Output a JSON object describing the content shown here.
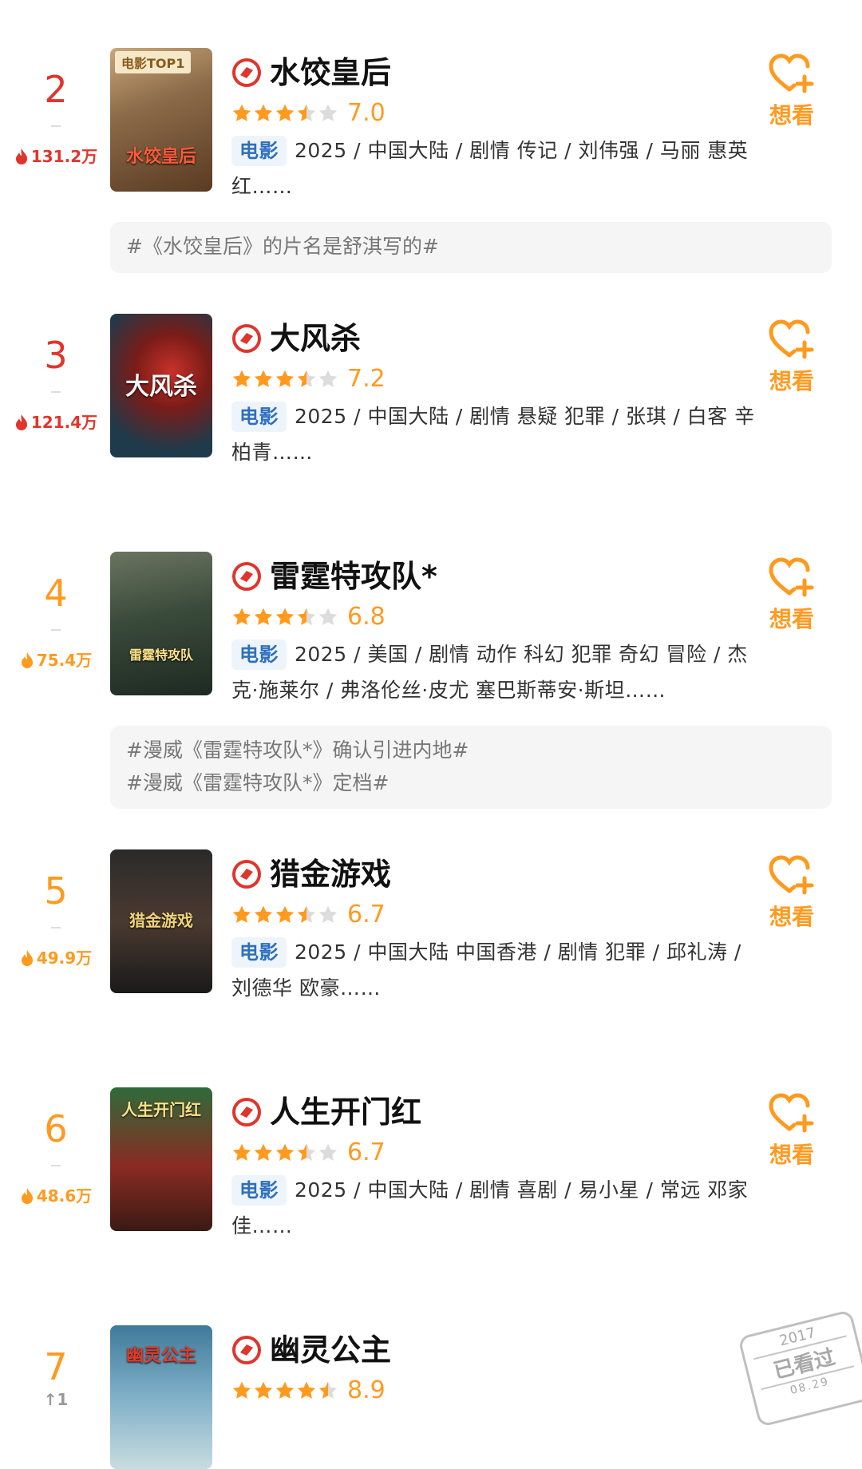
{
  "colors": {
    "rank_red": "#e0352c",
    "rank_orange": "#ff9a1f",
    "star_filled": "#ff9a1f",
    "star_empty": "#dcdcdc",
    "badge_text": "#2e6fbf",
    "want": "#ff9a1f"
  },
  "movies": [
    {
      "rank": "2",
      "heat": "131.2万",
      "title": "水饺皇后",
      "stars": 3.5,
      "score": "7.0",
      "category": "电影",
      "desc": "2025 / 中国大陆 / 剧情 传记 / 刘伟强 / 马丽 惠英红……",
      "want_label": "想看",
      "poster_tag": "电影TOP1",
      "poster_title": "水饺皇后",
      "topics": [
        "#《水饺皇后》的片名是舒淇写的#"
      ]
    },
    {
      "rank": "3",
      "heat": "121.4万",
      "title": "大风杀",
      "stars": 3.5,
      "score": "7.2",
      "category": "电影",
      "desc": "2025 / 中国大陆 / 剧情 悬疑 犯罪 / 张琪 / 白客 辛柏青……",
      "want_label": "想看",
      "poster_title": "大风杀"
    },
    {
      "rank": "4",
      "heat": "75.4万",
      "title": "雷霆特攻队*",
      "stars": 3.5,
      "score": "6.8",
      "category": "电影",
      "desc": "2025 / 美国 / 剧情 动作 科幻 犯罪 奇幻 冒险 / 杰克·施莱尔 / 弗洛伦丝·皮尤 塞巴斯蒂安·斯坦……",
      "want_label": "想看",
      "poster_title": "雷霆特攻队",
      "topics": [
        "#漫威《雷霆特攻队*》确认引进内地#",
        "#漫威《雷霆特攻队*》定档#"
      ]
    },
    {
      "rank": "5",
      "heat": "49.9万",
      "title": "猎金游戏",
      "stars": 3.5,
      "score": "6.7",
      "category": "电影",
      "desc": "2025 / 中国大陆 中国香港 / 剧情 犯罪 / 邱礼涛 / 刘德华 欧豪……",
      "want_label": "想看",
      "poster_title": "猎金游戏"
    },
    {
      "rank": "6",
      "heat": "48.6万",
      "title": "人生开门红",
      "stars": 3.5,
      "score": "6.7",
      "category": "电影",
      "desc": "2025 / 中国大陆 / 剧情 喜剧 / 易小星 / 常远 邓家佳……",
      "want_label": "想看",
      "poster_title": "人生开门红"
    },
    {
      "rank": "7",
      "rank_change": "↑1",
      "title": "幽灵公主",
      "stars": 4.5,
      "score": "8.9",
      "poster_title": "幽灵公主"
    }
  ],
  "stamp": {
    "year": "2017",
    "text": "已看过",
    "date": "08.29"
  }
}
